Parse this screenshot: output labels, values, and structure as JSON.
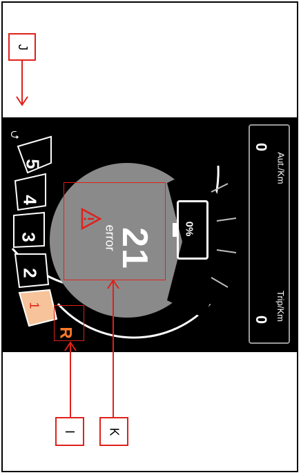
{
  "display": {
    "gears": [
      "R",
      "1",
      "2",
      "3",
      "4",
      "5"
    ],
    "active_gear": "R",
    "error_label": "error",
    "error_code": "21",
    "battery": "0%",
    "usb_icon": "usb-icon",
    "warning_icon": "warning-triangle-icon",
    "trip_label": "Trip/Km",
    "trip_value": "0",
    "aut_label": "Aut./Km",
    "aut_value": "0"
  },
  "callouts": {
    "J": "J",
    "I": "I",
    "K": "K"
  },
  "colors": {
    "accent": "#e0201a",
    "gear_highlight": "#f6c39a",
    "dial": "#8a8a8a"
  }
}
